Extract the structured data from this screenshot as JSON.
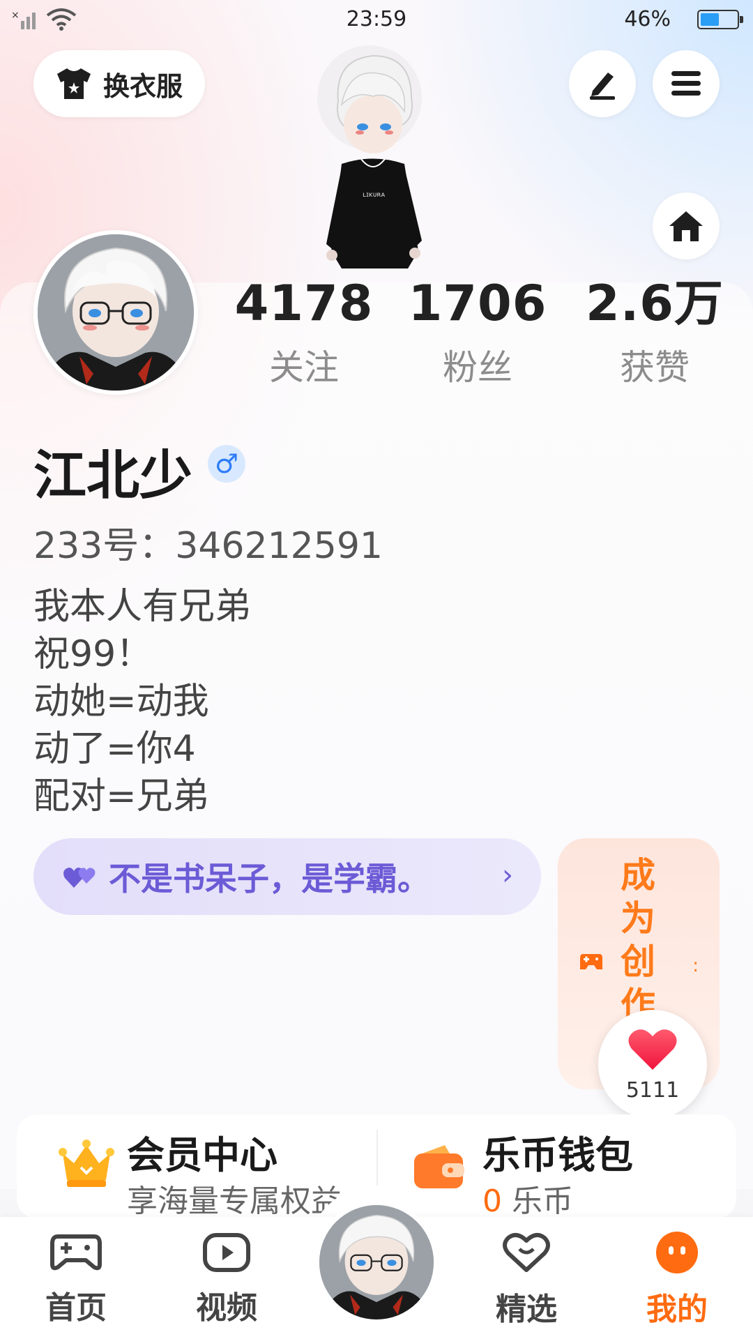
{
  "status_bar": {
    "time": "23:59",
    "battery_percent": "46%",
    "battery_level": 0.46
  },
  "top_actions": {
    "outfit_label": "换衣服"
  },
  "stats": [
    {
      "value": "4178",
      "label": "关注"
    },
    {
      "value": "1706",
      "label": "粉丝"
    },
    {
      "value": "2.6万",
      "label": "获赞"
    }
  ],
  "profile": {
    "name": "江北少",
    "gender_symbol": "♂",
    "id_text": "233号：346212591",
    "bio": [
      "我本人有兄弟",
      "祝99！",
      "动她=动我",
      "动了=你4",
      "配对=兄弟"
    ]
  },
  "tagline": {
    "text": "不是书呆子，是学霸。",
    "chevron": "›"
  },
  "creator": {
    "text": "成为创作",
    "dots": ":"
  },
  "like": {
    "count": "5111"
  },
  "features": {
    "vip": {
      "title": "会员中心",
      "subtitle": "享海量专属权益"
    },
    "wallet": {
      "title": "乐币钱包",
      "amount": "0",
      "unit": " 乐币"
    }
  },
  "tabs": [
    {
      "label": "首页",
      "icon": "gamepad-icon"
    },
    {
      "label": "视频",
      "icon": "video-icon"
    },
    {
      "label": "精选",
      "icon": "heart-chat-icon"
    },
    {
      "label": "我的",
      "icon": "face-icon"
    }
  ],
  "colors": {
    "accent": "#ff6b10",
    "tagline_text": "#6b5bd6",
    "gender_blue": "#2f7df6"
  }
}
